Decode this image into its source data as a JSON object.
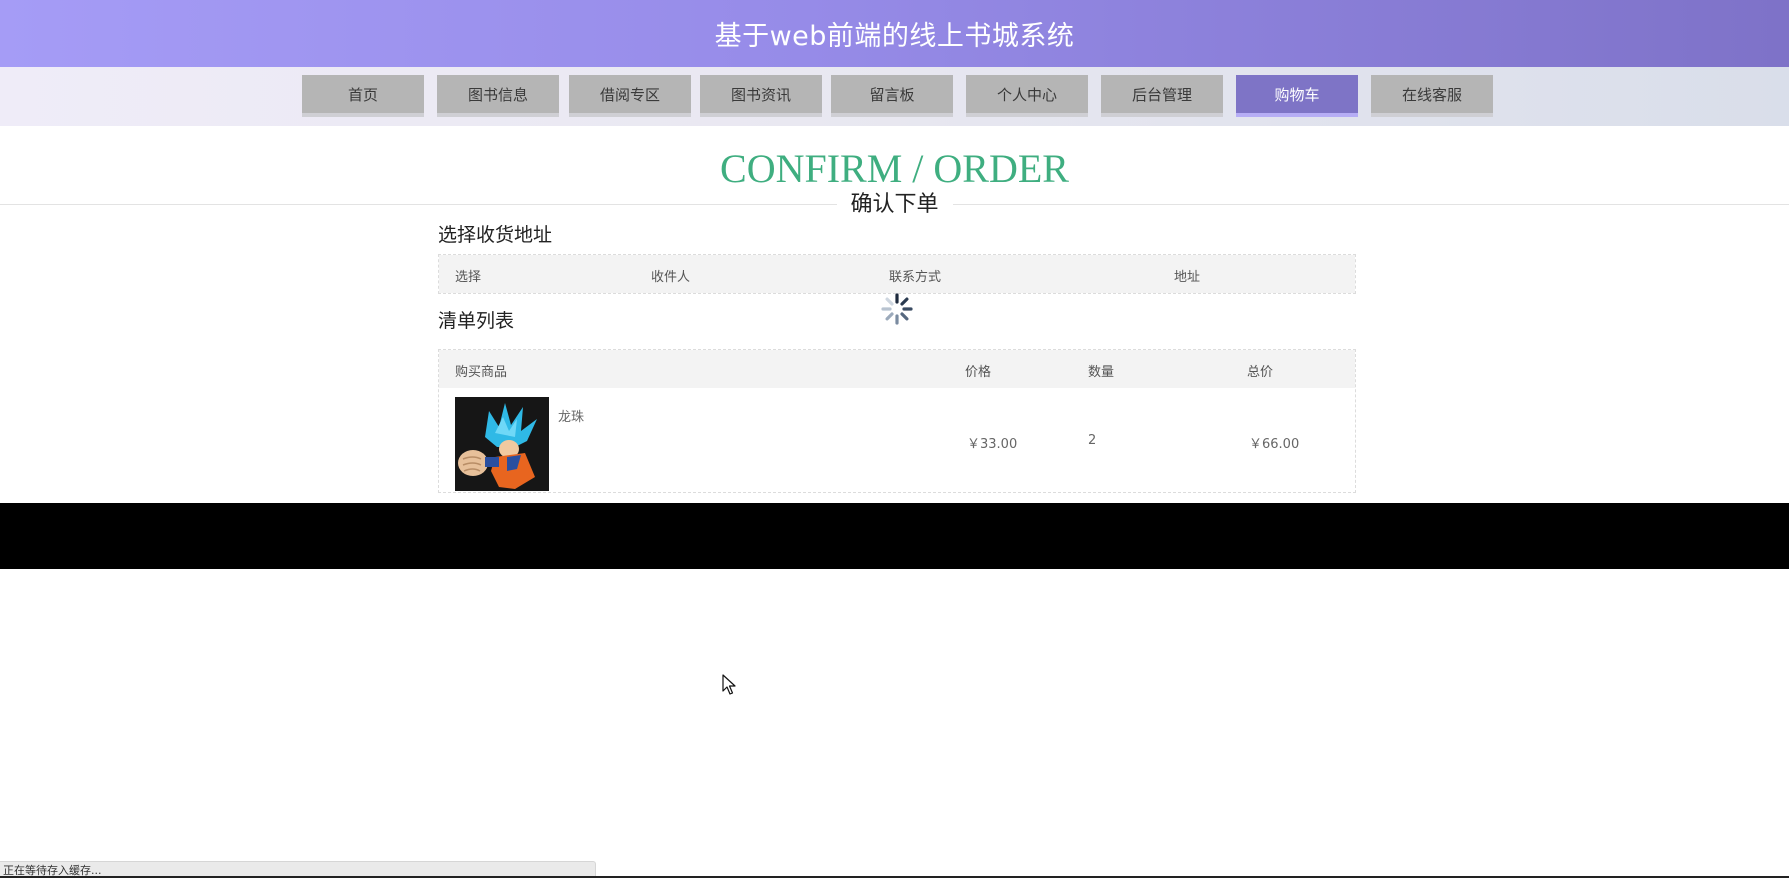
{
  "header": {
    "title": "基于web前端的线上书城系统"
  },
  "nav": {
    "items": [
      {
        "label": "首页"
      },
      {
        "label": "图书信息"
      },
      {
        "label": "借阅专区"
      },
      {
        "label": "图书资讯"
      },
      {
        "label": "留言板"
      },
      {
        "label": "个人中心"
      },
      {
        "label": "后台管理"
      },
      {
        "label": "购物车"
      },
      {
        "label": "在线客服"
      }
    ],
    "active_index": 7
  },
  "page": {
    "heading": "CONFIRM / ORDER",
    "subheading": "确认下单"
  },
  "address_section": {
    "title": "选择收货地址",
    "columns": [
      "选择",
      "收件人",
      "联系方式",
      "地址"
    ]
  },
  "order_section": {
    "title": "清单列表",
    "columns": [
      "购买商品",
      "价格",
      "数量",
      "总价"
    ],
    "rows": [
      {
        "name": "龙珠",
        "price": "￥33.00",
        "quantity": "2",
        "total": "￥66.00"
      }
    ]
  },
  "status_bar": {
    "text": "正在等待存入缓存..."
  },
  "colors": {
    "header_accent": "#968be8",
    "nav_active": "#7e74c6",
    "heading_green": "#3fae80"
  },
  "icons": [
    "loading-spinner-icon",
    "mouse-pointer-icon"
  ]
}
